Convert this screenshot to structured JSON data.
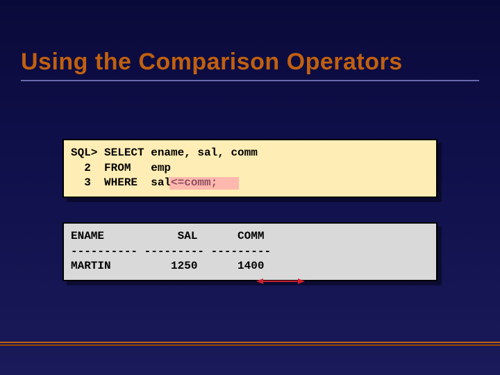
{
  "title": "Using the Comparison Operators",
  "sql_box": {
    "line1": "SQL> SELECT ename, sal, comm",
    "line2": "  2  FROM   emp",
    "line3": "  3  WHERE  sal<=comm;"
  },
  "result_box": {
    "header": "ENAME           SAL      COMM",
    "divider": "---------- --------- ---------",
    "row1": "MARTIN         1250      1400"
  }
}
